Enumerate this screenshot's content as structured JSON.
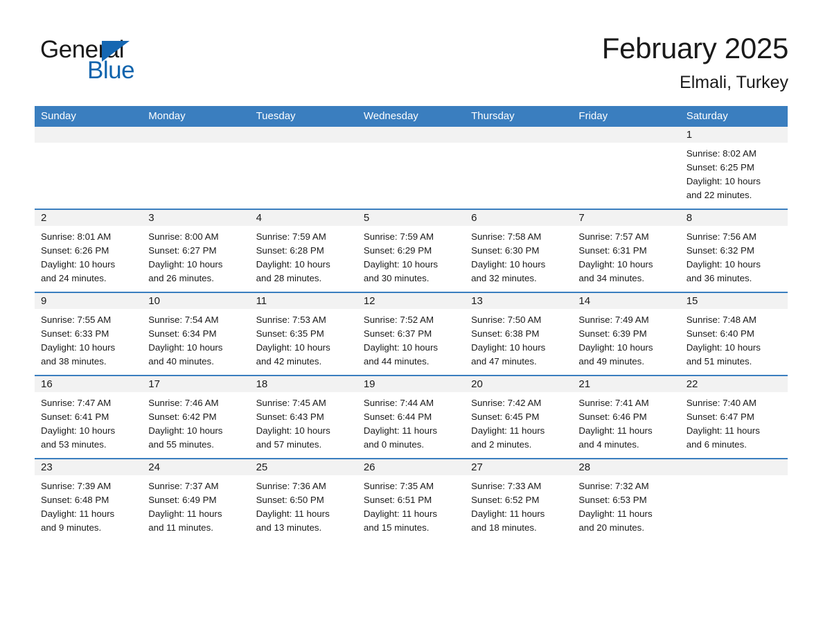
{
  "logo": {
    "word_general": "General",
    "word_blue": "Blue",
    "triangle_color": "#1567b2",
    "blue_text_color": "#1064ad"
  },
  "header": {
    "month_title": "February 2025",
    "location": "Elmali, Turkey"
  },
  "theme": {
    "header_blue": "#3a7ebf",
    "row_rule_blue": "#3a7ebf",
    "daynum_band": "#f2f2f2",
    "text": "#1a1a1a"
  },
  "columns": [
    "Sunday",
    "Monday",
    "Tuesday",
    "Wednesday",
    "Thursday",
    "Friday",
    "Saturday"
  ],
  "weeks": [
    [
      {
        "day": "",
        "empty": true
      },
      {
        "day": "",
        "empty": true
      },
      {
        "day": "",
        "empty": true
      },
      {
        "day": "",
        "empty": true
      },
      {
        "day": "",
        "empty": true
      },
      {
        "day": "",
        "empty": true
      },
      {
        "day": "1",
        "sunrise": "Sunrise: 8:02 AM",
        "sunset": "Sunset: 6:25 PM",
        "daylight1": "Daylight: 10 hours",
        "daylight2": "and 22 minutes."
      }
    ],
    [
      {
        "day": "2",
        "sunrise": "Sunrise: 8:01 AM",
        "sunset": "Sunset: 6:26 PM",
        "daylight1": "Daylight: 10 hours",
        "daylight2": "and 24 minutes."
      },
      {
        "day": "3",
        "sunrise": "Sunrise: 8:00 AM",
        "sunset": "Sunset: 6:27 PM",
        "daylight1": "Daylight: 10 hours",
        "daylight2": "and 26 minutes."
      },
      {
        "day": "4",
        "sunrise": "Sunrise: 7:59 AM",
        "sunset": "Sunset: 6:28 PM",
        "daylight1": "Daylight: 10 hours",
        "daylight2": "and 28 minutes."
      },
      {
        "day": "5",
        "sunrise": "Sunrise: 7:59 AM",
        "sunset": "Sunset: 6:29 PM",
        "daylight1": "Daylight: 10 hours",
        "daylight2": "and 30 minutes."
      },
      {
        "day": "6",
        "sunrise": "Sunrise: 7:58 AM",
        "sunset": "Sunset: 6:30 PM",
        "daylight1": "Daylight: 10 hours",
        "daylight2": "and 32 minutes."
      },
      {
        "day": "7",
        "sunrise": "Sunrise: 7:57 AM",
        "sunset": "Sunset: 6:31 PM",
        "daylight1": "Daylight: 10 hours",
        "daylight2": "and 34 minutes."
      },
      {
        "day": "8",
        "sunrise": "Sunrise: 7:56 AM",
        "sunset": "Sunset: 6:32 PM",
        "daylight1": "Daylight: 10 hours",
        "daylight2": "and 36 minutes."
      }
    ],
    [
      {
        "day": "9",
        "sunrise": "Sunrise: 7:55 AM",
        "sunset": "Sunset: 6:33 PM",
        "daylight1": "Daylight: 10 hours",
        "daylight2": "and 38 minutes."
      },
      {
        "day": "10",
        "sunrise": "Sunrise: 7:54 AM",
        "sunset": "Sunset: 6:34 PM",
        "daylight1": "Daylight: 10 hours",
        "daylight2": "and 40 minutes."
      },
      {
        "day": "11",
        "sunrise": "Sunrise: 7:53 AM",
        "sunset": "Sunset: 6:35 PM",
        "daylight1": "Daylight: 10 hours",
        "daylight2": "and 42 minutes."
      },
      {
        "day": "12",
        "sunrise": "Sunrise: 7:52 AM",
        "sunset": "Sunset: 6:37 PM",
        "daylight1": "Daylight: 10 hours",
        "daylight2": "and 44 minutes."
      },
      {
        "day": "13",
        "sunrise": "Sunrise: 7:50 AM",
        "sunset": "Sunset: 6:38 PM",
        "daylight1": "Daylight: 10 hours",
        "daylight2": "and 47 minutes."
      },
      {
        "day": "14",
        "sunrise": "Sunrise: 7:49 AM",
        "sunset": "Sunset: 6:39 PM",
        "daylight1": "Daylight: 10 hours",
        "daylight2": "and 49 minutes."
      },
      {
        "day": "15",
        "sunrise": "Sunrise: 7:48 AM",
        "sunset": "Sunset: 6:40 PM",
        "daylight1": "Daylight: 10 hours",
        "daylight2": "and 51 minutes."
      }
    ],
    [
      {
        "day": "16",
        "sunrise": "Sunrise: 7:47 AM",
        "sunset": "Sunset: 6:41 PM",
        "daylight1": "Daylight: 10 hours",
        "daylight2": "and 53 minutes."
      },
      {
        "day": "17",
        "sunrise": "Sunrise: 7:46 AM",
        "sunset": "Sunset: 6:42 PM",
        "daylight1": "Daylight: 10 hours",
        "daylight2": "and 55 minutes."
      },
      {
        "day": "18",
        "sunrise": "Sunrise: 7:45 AM",
        "sunset": "Sunset: 6:43 PM",
        "daylight1": "Daylight: 10 hours",
        "daylight2": "and 57 minutes."
      },
      {
        "day": "19",
        "sunrise": "Sunrise: 7:44 AM",
        "sunset": "Sunset: 6:44 PM",
        "daylight1": "Daylight: 11 hours",
        "daylight2": "and 0 minutes."
      },
      {
        "day": "20",
        "sunrise": "Sunrise: 7:42 AM",
        "sunset": "Sunset: 6:45 PM",
        "daylight1": "Daylight: 11 hours",
        "daylight2": "and 2 minutes."
      },
      {
        "day": "21",
        "sunrise": "Sunrise: 7:41 AM",
        "sunset": "Sunset: 6:46 PM",
        "daylight1": "Daylight: 11 hours",
        "daylight2": "and 4 minutes."
      },
      {
        "day": "22",
        "sunrise": "Sunrise: 7:40 AM",
        "sunset": "Sunset: 6:47 PM",
        "daylight1": "Daylight: 11 hours",
        "daylight2": "and 6 minutes."
      }
    ],
    [
      {
        "day": "23",
        "sunrise": "Sunrise: 7:39 AM",
        "sunset": "Sunset: 6:48 PM",
        "daylight1": "Daylight: 11 hours",
        "daylight2": "and 9 minutes."
      },
      {
        "day": "24",
        "sunrise": "Sunrise: 7:37 AM",
        "sunset": "Sunset: 6:49 PM",
        "daylight1": "Daylight: 11 hours",
        "daylight2": "and 11 minutes."
      },
      {
        "day": "25",
        "sunrise": "Sunrise: 7:36 AM",
        "sunset": "Sunset: 6:50 PM",
        "daylight1": "Daylight: 11 hours",
        "daylight2": "and 13 minutes."
      },
      {
        "day": "26",
        "sunrise": "Sunrise: 7:35 AM",
        "sunset": "Sunset: 6:51 PM",
        "daylight1": "Daylight: 11 hours",
        "daylight2": "and 15 minutes."
      },
      {
        "day": "27",
        "sunrise": "Sunrise: 7:33 AM",
        "sunset": "Sunset: 6:52 PM",
        "daylight1": "Daylight: 11 hours",
        "daylight2": "and 18 minutes."
      },
      {
        "day": "28",
        "sunrise": "Sunrise: 7:32 AM",
        "sunset": "Sunset: 6:53 PM",
        "daylight1": "Daylight: 11 hours",
        "daylight2": "and 20 minutes."
      },
      {
        "day": "",
        "empty": true
      }
    ]
  ]
}
